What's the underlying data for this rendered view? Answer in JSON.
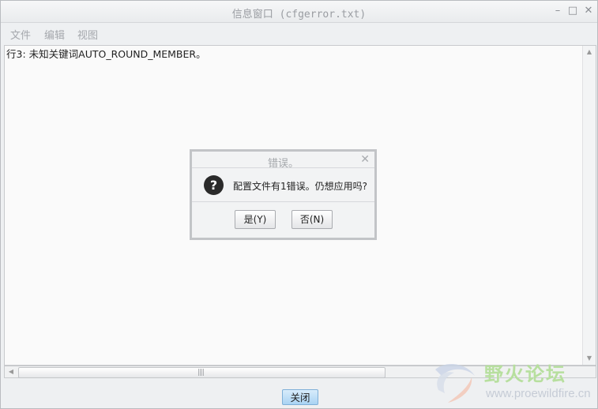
{
  "window": {
    "title": "信息窗口 (cfgerror.txt)"
  },
  "menu": {
    "items": [
      "文件",
      "编辑",
      "视图"
    ]
  },
  "content": {
    "lines": [
      "行3: 未知关键词AUTO_ROUND_MEMBER。"
    ]
  },
  "scrollbar": {
    "grip": "||||"
  },
  "footer": {
    "close_label": "关闭"
  },
  "dialog": {
    "title": "错误。",
    "icon": "question-icon",
    "message": "配置文件有1错误。仍想应用吗?",
    "yes_label": "是(Y)",
    "no_label": "否(N)"
  },
  "watermark": {
    "title": "野火论坛",
    "url": "www.proewildfire.cn"
  },
  "colors": {
    "accent_button": "#a9d3f3",
    "watermark_green": "#b7df9e"
  }
}
